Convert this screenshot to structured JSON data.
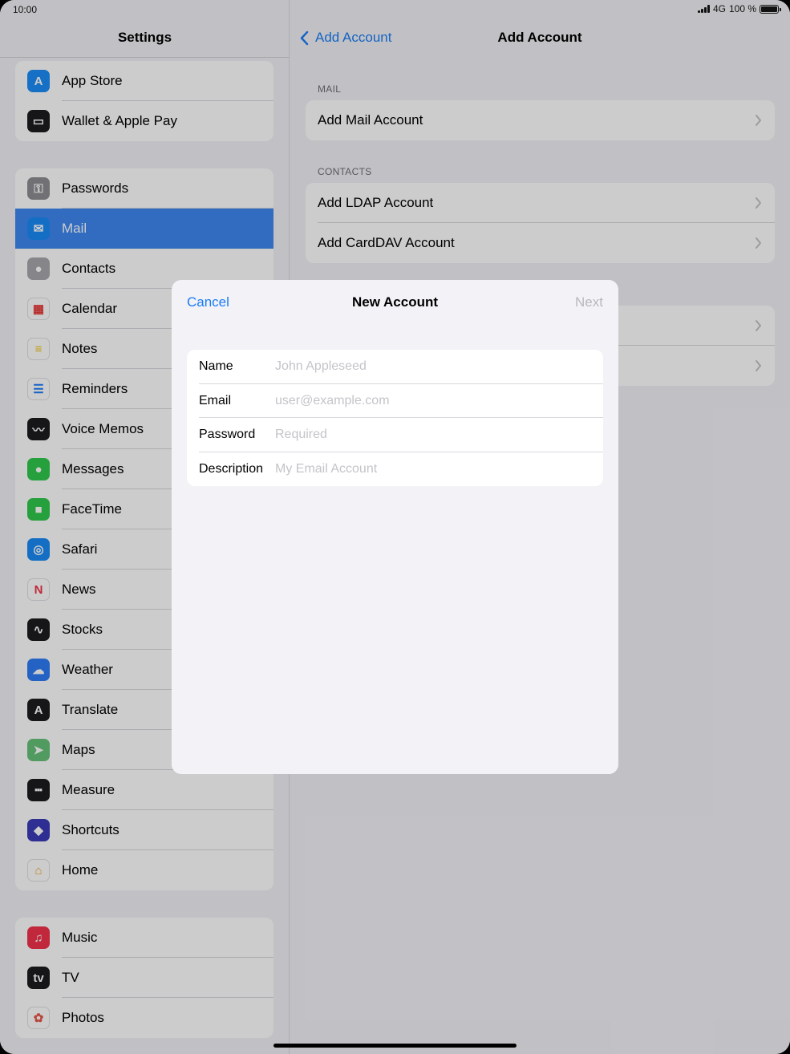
{
  "status": {
    "time": "10:00",
    "network": "4G",
    "battery": "100 %"
  },
  "sidebar": {
    "title": "Settings",
    "groups": [
      {
        "items": [
          {
            "label": "App Store",
            "icon": "app-store-icon",
            "color": "#1c8cf7"
          },
          {
            "label": "Wallet & Apple Pay",
            "icon": "wallet-icon",
            "color": "#1c1c1e"
          }
        ]
      },
      {
        "items": [
          {
            "label": "Passwords",
            "icon": "key-icon",
            "color": "#8e8e93"
          },
          {
            "label": "Mail",
            "icon": "mail-icon",
            "color": "#1a8bf6",
            "selected": true
          },
          {
            "label": "Contacts",
            "icon": "contacts-icon",
            "color": "#a8a8ad"
          },
          {
            "label": "Calendar",
            "icon": "calendar-icon",
            "color": "#ffffff"
          },
          {
            "label": "Notes",
            "icon": "notes-icon",
            "color": "#ffffff"
          },
          {
            "label": "Reminders",
            "icon": "reminders-icon",
            "color": "#ffffff"
          },
          {
            "label": "Voice Memos",
            "icon": "voice-memos-icon",
            "color": "#1c1c1e"
          },
          {
            "label": "Messages",
            "icon": "messages-icon",
            "color": "#30c94d"
          },
          {
            "label": "FaceTime",
            "icon": "facetime-icon",
            "color": "#30c94d"
          },
          {
            "label": "Safari",
            "icon": "safari-icon",
            "color": "#1a8bf6"
          },
          {
            "label": "News",
            "icon": "news-icon",
            "color": "#ffffff"
          },
          {
            "label": "Stocks",
            "icon": "stocks-icon",
            "color": "#1c1c1e"
          },
          {
            "label": "Weather",
            "icon": "weather-icon",
            "color": "#2e7cf6"
          },
          {
            "label": "Translate",
            "icon": "translate-icon",
            "color": "#1c1c1e"
          },
          {
            "label": "Maps",
            "icon": "maps-icon",
            "color": "#66c27a"
          },
          {
            "label": "Measure",
            "icon": "measure-icon",
            "color": "#1c1c1e"
          },
          {
            "label": "Shortcuts",
            "icon": "shortcuts-icon",
            "color": "#3a3ab8"
          },
          {
            "label": "Home",
            "icon": "home-icon",
            "color": "#ffffff"
          }
        ]
      },
      {
        "items": [
          {
            "label": "Music",
            "icon": "music-icon",
            "color": "#f2334a"
          },
          {
            "label": "TV",
            "icon": "tv-icon",
            "color": "#1c1c1e"
          },
          {
            "label": "Photos",
            "icon": "photos-icon",
            "color": "#ffffff"
          }
        ]
      }
    ]
  },
  "detail": {
    "back_label": "Add Account",
    "title": "Add Account",
    "mail_section": "MAIL",
    "mail_items": [
      "Add Mail Account"
    ],
    "contacts_section": "CONTACTS",
    "contacts_items": [
      "Add LDAP Account",
      "Add CardDAV Account"
    ],
    "calendars_items": [
      "",
      ""
    ]
  },
  "modal": {
    "cancel_label": "Cancel",
    "title": "New Account",
    "next_label": "Next",
    "fields": [
      {
        "label": "Name",
        "placeholder": "John Appleseed",
        "value": ""
      },
      {
        "label": "Email",
        "placeholder": "user@example.com",
        "value": ""
      },
      {
        "label": "Password",
        "placeholder": "Required",
        "value": ""
      },
      {
        "label": "Description",
        "placeholder": "My Email Account",
        "value": ""
      }
    ]
  },
  "colors": {
    "accent": "#1a7cf5",
    "selected_row": "#3f88f2",
    "disabled": "#b8b8bd"
  }
}
